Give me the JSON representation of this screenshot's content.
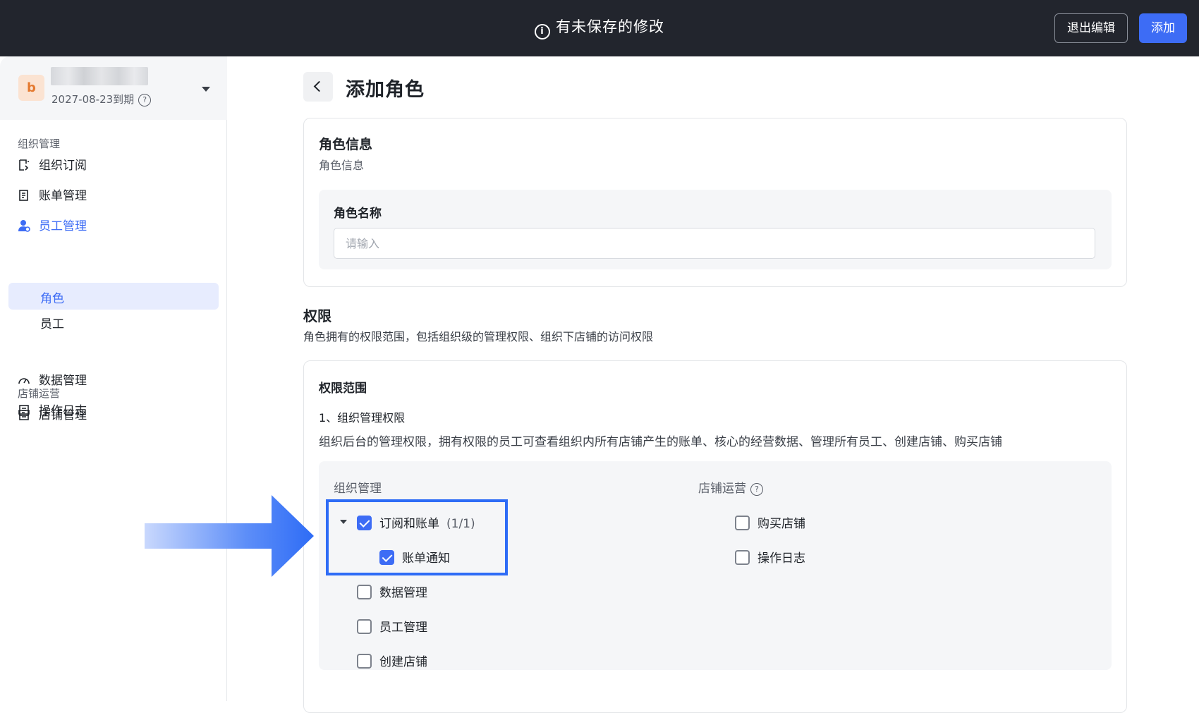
{
  "topbar": {
    "notice": "有未保存的修改",
    "exit_label": "退出编辑",
    "add_label": "添加"
  },
  "sidebar": {
    "org": {
      "avatar_letter": "b",
      "expire": "2027-08-23到期"
    },
    "sections": [
      {
        "title": "组织管理",
        "items": [
          {
            "label": "组织订阅",
            "icon": "subscription-icon"
          },
          {
            "label": "账单管理",
            "icon": "bill-icon"
          },
          {
            "label": "员工管理",
            "icon": "staff-icon",
            "sub": [
              "员工",
              "角色"
            ]
          },
          {
            "label": "数据管理",
            "icon": "dashboard-icon"
          },
          {
            "label": "操作日志",
            "icon": "log-icon"
          }
        ]
      },
      {
        "title": "店铺运营",
        "items": [
          {
            "label": "店铺管理",
            "icon": "store-icon"
          }
        ]
      }
    ]
  },
  "main": {
    "title": "添加角色",
    "role_info": {
      "title": "角色信息",
      "subtitle": "角色信息",
      "name_label": "角色名称",
      "name_placeholder": "请输入",
      "name_value": ""
    },
    "permissions": {
      "title": "权限",
      "desc": "角色拥有的权限范围，包括组织级的管理权限、组织下店铺的访问权限",
      "scope_title": "权限范围",
      "scope_sub": "1、组织管理权限",
      "scope_desc": "组织后台的管理权限，拥有权限的员工可查看组织内所有店铺产生的账单、核心的经营数据、管理所有员工、创建店铺、购买店铺",
      "org_column": {
        "title": "组织管理",
        "items": [
          {
            "label": "订阅和账单",
            "count": "(1/1)",
            "checked": true
          },
          {
            "label": "账单通知",
            "checked": true
          },
          {
            "label": "数据管理",
            "checked": false
          },
          {
            "label": "员工管理",
            "checked": false
          },
          {
            "label": "创建店铺",
            "checked": false
          }
        ]
      },
      "store_column": {
        "title": "店铺运营",
        "items": [
          {
            "label": "购买店铺",
            "checked": false
          },
          {
            "label": "操作日志",
            "checked": false
          }
        ]
      }
    }
  },
  "colors": {
    "accent": "#3d6cf5",
    "topbar": "#22252d",
    "highlight": "#2e6cf6"
  }
}
